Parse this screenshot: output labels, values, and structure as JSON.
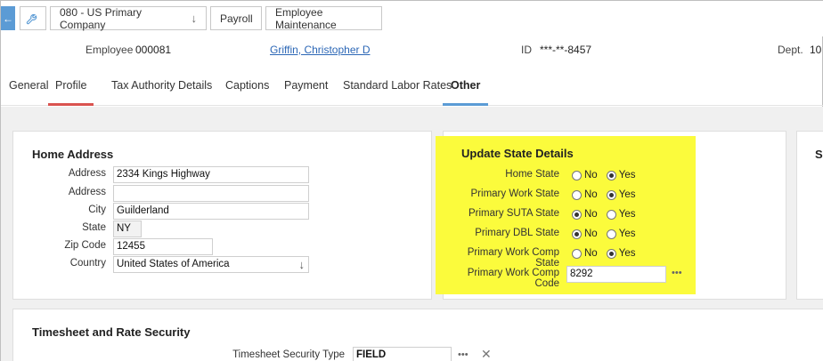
{
  "breadcrumb": {
    "company": "080 - US Primary Company",
    "module": "Payroll",
    "page": "Employee Maintenance"
  },
  "employee": {
    "label": "Employee",
    "number": "000081",
    "name": "Griffin, Christopher D",
    "id_label": "ID",
    "id_value": "***-**-8457",
    "dept_label": "Dept.",
    "dept_value": "10"
  },
  "tabs": [
    "General",
    "Profile",
    "Tax Authority Details",
    "Captions",
    "Payment",
    "Standard Labor Rates",
    "Other"
  ],
  "home_address": {
    "title": "Home Address",
    "address1_label": "Address",
    "address1": "2334 Kings Highway",
    "address2_label": "Address",
    "address2": "",
    "city_label": "City",
    "city": "Guilderland",
    "state_label": "State",
    "state": "NY",
    "zip_label": "Zip Code",
    "zip": "12455",
    "country_label": "Country",
    "country": "United States of America"
  },
  "update_state": {
    "title": "Update State Details",
    "no_label": "No",
    "yes_label": "Yes",
    "rows": [
      {
        "label": "Home State",
        "value": "Yes"
      },
      {
        "label": "Primary Work State",
        "value": "Yes"
      },
      {
        "label": "Primary SUTA State",
        "value": "No"
      },
      {
        "label": "Primary DBL State",
        "value": "No"
      },
      {
        "label": "Primary Work Comp State",
        "value": "Yes"
      }
    ],
    "work_comp_code_label": "Primary Work Comp Code",
    "work_comp_code": "8292"
  },
  "right_panel": {
    "title_fragment": "S"
  },
  "timesheet": {
    "title": "Timesheet and Rate Security",
    "security_type_label": "Timesheet Security Type",
    "security_type": "FIELD"
  },
  "icons": {
    "back": "arrow-left-icon",
    "wrench": "wrench-icon",
    "chevron": "chevron-down-icon",
    "lookup": "ellipsis-icon",
    "clear": "close-icon"
  },
  "colors": {
    "accent_blue": "#5b9bd5",
    "accent_red": "#d9534f",
    "highlight": "#fbfb3c",
    "link": "#2c67b6"
  }
}
